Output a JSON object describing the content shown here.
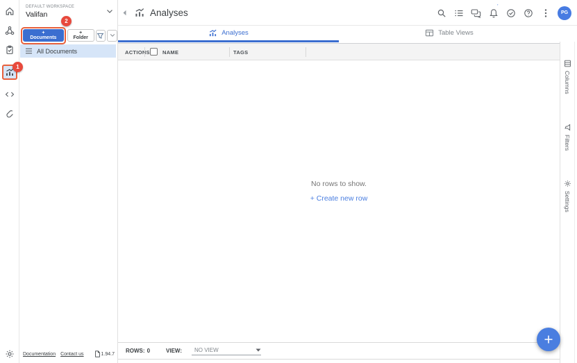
{
  "colors": {
    "primary_blue": "#3b6ed0",
    "selection_blue": "#d6e5f8",
    "badge_red": "#e8493c",
    "highlight_orange": "#e8603c",
    "fab_blue": "#4a7ee0"
  },
  "annotations": {
    "step_1": "1",
    "step_2": "2"
  },
  "sidebar": {
    "workspace": {
      "label": "DEFAULT WORKSPACE",
      "name": "Valifan"
    },
    "buttons": {
      "documents": "+ Documents",
      "folder": "+ Folder"
    },
    "all_documents": "All Documents",
    "footer": {
      "documentation": "Documentation",
      "contact": "Contact us",
      "version": "1.94.7"
    }
  },
  "header": {
    "title": "Analyses",
    "avatar": "PG"
  },
  "tabs": {
    "analyses": "Analyses",
    "table_views": "Table Views"
  },
  "table": {
    "columns": {
      "actions": "ACTIONS",
      "name": "NAME",
      "tags": "TAGS"
    },
    "empty": {
      "message": "No rows to show.",
      "create": "+ Create new row"
    }
  },
  "right_panel": {
    "tabs": [
      {
        "label": "Columns"
      },
      {
        "label": "Filters"
      },
      {
        "label": "Settings"
      }
    ]
  },
  "status_bar": {
    "rows_label": "ROWS:",
    "rows_value": "0",
    "view_label": "VIEW:",
    "view_value": "NO VIEW"
  }
}
